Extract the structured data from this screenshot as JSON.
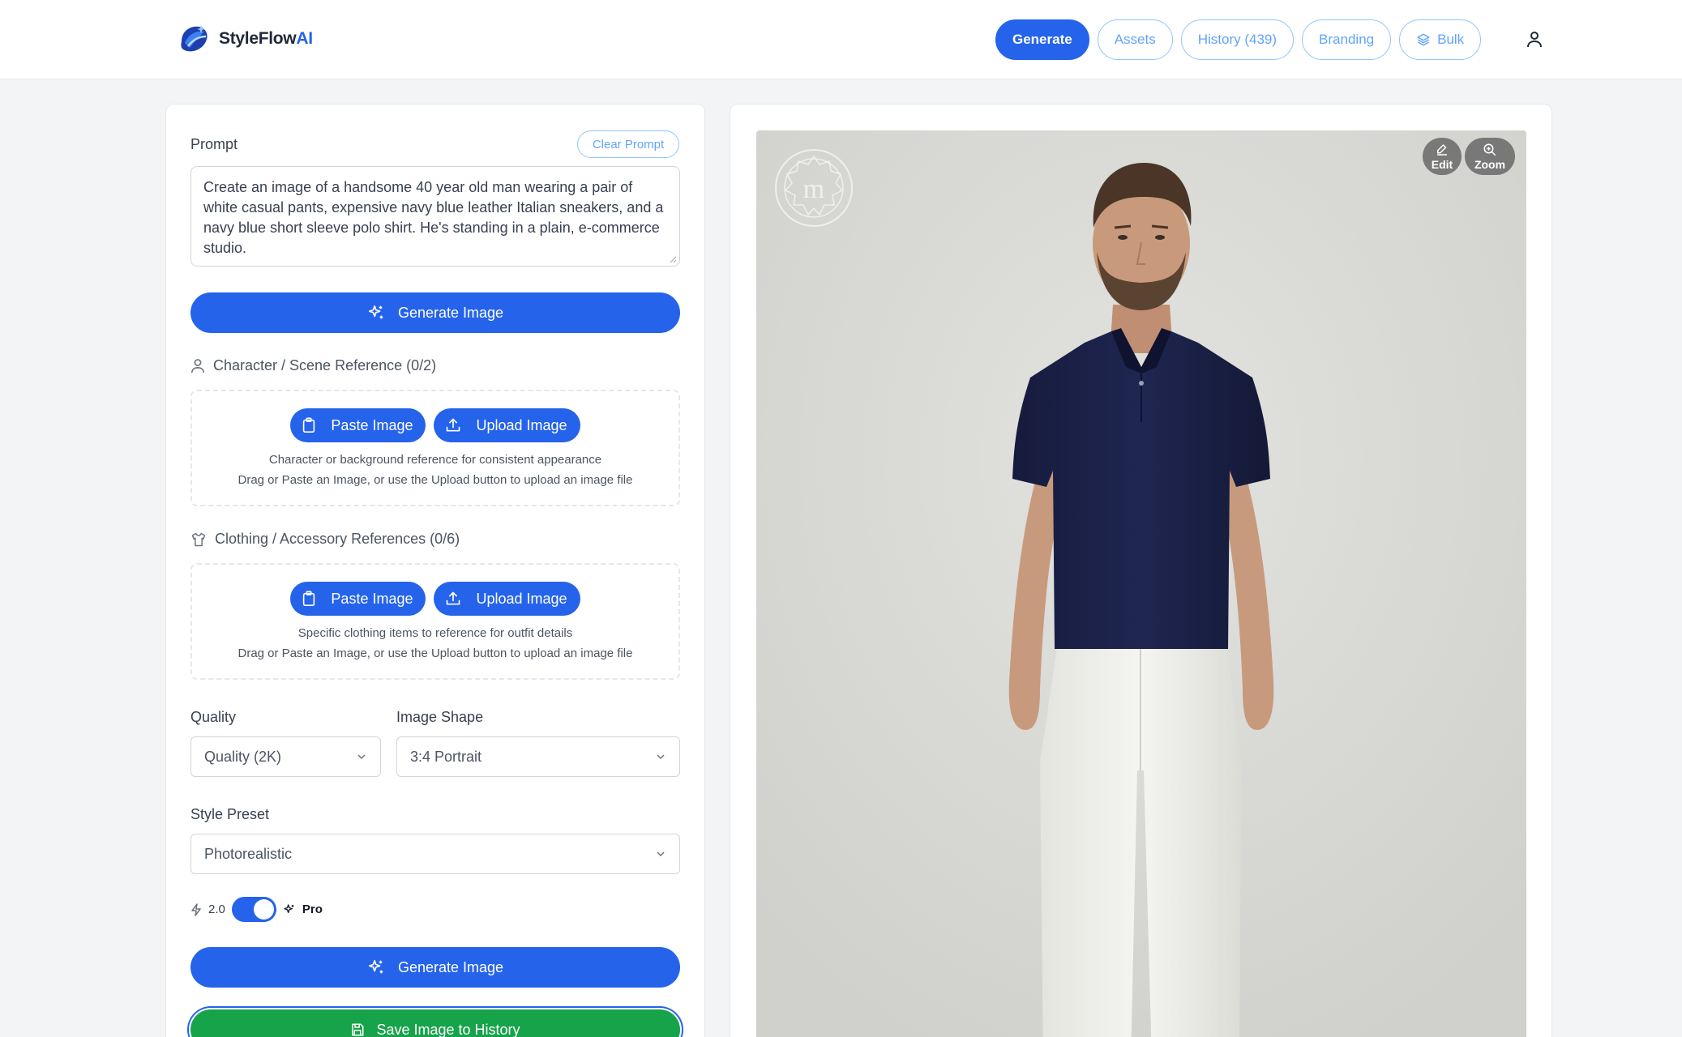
{
  "app": {
    "brand_main": "StyleFlow",
    "brand_accent": "AI"
  },
  "nav": {
    "generate": "Generate",
    "assets": "Assets",
    "history": "History (439)",
    "branding": "Branding",
    "bulk": "Bulk"
  },
  "prompt": {
    "label": "Prompt",
    "clear_label": "Clear Prompt",
    "text": "Create an image of a handsome 40 year old man wearing a pair of white casual pants, expensive navy blue leather Italian sneakers, and a navy blue short sleeve polo shirt.  He's standing in a plain, e-commerce studio."
  },
  "generate_label": "Generate Image",
  "character_ref": {
    "title": "Character / Scene Reference (0/2)",
    "paste_label": "Paste Image",
    "upload_label": "Upload Image",
    "hint1": "Character or background reference for consistent appearance",
    "hint2": "Drag or Paste an Image, or use the Upload button to upload an image file"
  },
  "clothing_ref": {
    "title": "Clothing / Accessory References (0/6)",
    "paste_label": "Paste Image",
    "upload_label": "Upload Image",
    "hint1": "Specific clothing items to reference for outfit details",
    "hint2": "Drag or Paste an Image, or use the Upload button to upload an image file"
  },
  "quality": {
    "label": "Quality",
    "value": "Quality (2K)"
  },
  "shape": {
    "label": "Image Shape",
    "value": "3:4 Portrait"
  },
  "style": {
    "label": "Style Preset",
    "value": "Photorealistic"
  },
  "model_toggle": {
    "left_label": "2.0",
    "right_label": "Pro",
    "enabled": true
  },
  "save_label": "Save Image to History",
  "preview": {
    "edit_label": "Edit",
    "zoom_label": "Zoom",
    "watermark_letter": "m"
  },
  "colors": {
    "primary": "#2563eb",
    "success": "#16a34a",
    "outline": "#93c5fd",
    "shirt": "#1b2147",
    "pants": "#eeeeea"
  }
}
